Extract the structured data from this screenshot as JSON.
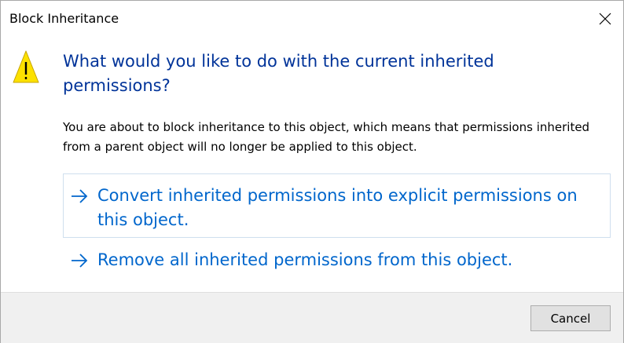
{
  "window": {
    "title": "Block Inheritance",
    "close_icon": "close-icon"
  },
  "content": {
    "icon": "warning-icon",
    "headline": "What would you like to do with the current inherited permissions?",
    "description": "You are about to block inheritance to this object, which means that permissions inherited from a parent object will no longer be applied to this object."
  },
  "options": [
    {
      "icon": "arrow-right-icon",
      "label": "Convert inherited permissions into explicit permissions on this object."
    },
    {
      "icon": "arrow-right-icon",
      "label": "Remove all inherited permissions from this object."
    }
  ],
  "footer": {
    "cancel_label": "Cancel"
  },
  "colors": {
    "headline": "#003399",
    "command_link": "#0066CC",
    "footer_background": "#F0F0F0",
    "warning_fill": "#FCE100"
  }
}
